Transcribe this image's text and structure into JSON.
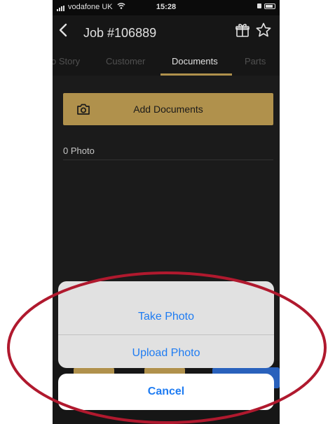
{
  "status_bar": {
    "carrier": "vodafone UK",
    "time": "15:28"
  },
  "header": {
    "title": "Job #106889",
    "icons": [
      "back-chevron-icon",
      "gift-icon",
      "star-icon"
    ]
  },
  "tabs": [
    {
      "label": "o Story",
      "active": false
    },
    {
      "label": "Customer",
      "active": false
    },
    {
      "label": "Documents",
      "active": true
    },
    {
      "label": "Parts",
      "active": false
    }
  ],
  "documents": {
    "add_button_label": "Add Documents",
    "photo_count": "0 Photo"
  },
  "action_sheet": {
    "take_photo": "Take Photo",
    "upload_photo": "Upload Photo",
    "cancel": "Cancel"
  },
  "colors": {
    "accent_gold": "#c9a557",
    "ios_blue": "#1f7cf2",
    "annotation_red": "#b0192e",
    "background_dark": "#1f1f1f"
  }
}
